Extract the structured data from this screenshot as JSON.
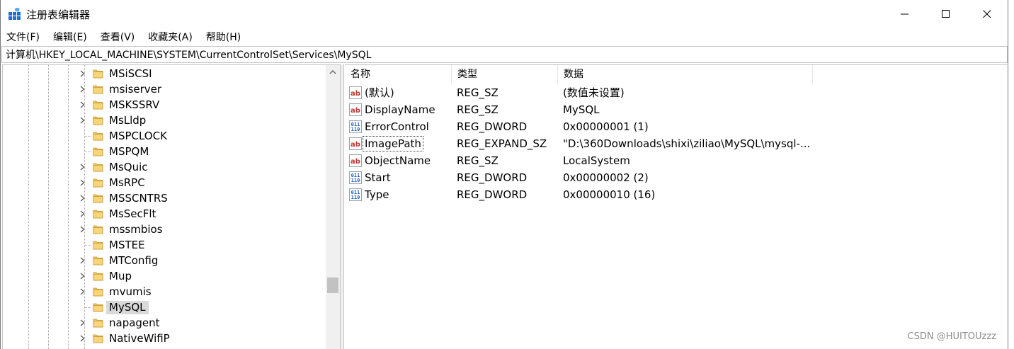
{
  "window": {
    "title": "注册表编辑器",
    "minimize_glyph": "minimize",
    "maximize_glyph": "maximize",
    "close_glyph": "close"
  },
  "menu": [
    {
      "label": "文件(F)"
    },
    {
      "label": "编辑(E)"
    },
    {
      "label": "查看(V)"
    },
    {
      "label": "收藏夹(A)"
    },
    {
      "label": "帮助(H)"
    }
  ],
  "address": {
    "path": "计算机\\HKEY_LOCAL_MACHINE\\SYSTEM\\CurrentControlSet\\Services\\MySQL"
  },
  "tree": {
    "items": [
      {
        "label": "MSiSCSI",
        "expandable": true,
        "selected": false
      },
      {
        "label": "msiserver",
        "expandable": true,
        "selected": false
      },
      {
        "label": "MSKSSRV",
        "expandable": true,
        "selected": false
      },
      {
        "label": "MsLldp",
        "expandable": true,
        "selected": false
      },
      {
        "label": "MSPCLOCK",
        "expandable": false,
        "selected": false
      },
      {
        "label": "MSPQM",
        "expandable": false,
        "selected": false
      },
      {
        "label": "MsQuic",
        "expandable": true,
        "selected": false
      },
      {
        "label": "MsRPC",
        "expandable": true,
        "selected": false
      },
      {
        "label": "MSSCNTRS",
        "expandable": true,
        "selected": false
      },
      {
        "label": "MsSecFlt",
        "expandable": true,
        "selected": false
      },
      {
        "label": "mssmbios",
        "expandable": true,
        "selected": false
      },
      {
        "label": "MSTEE",
        "expandable": false,
        "selected": false
      },
      {
        "label": "MTConfig",
        "expandable": true,
        "selected": false
      },
      {
        "label": "Mup",
        "expandable": true,
        "selected": false
      },
      {
        "label": "mvumis",
        "expandable": true,
        "selected": false
      },
      {
        "label": "MySQL",
        "expandable": false,
        "selected": true
      },
      {
        "label": "napagent",
        "expandable": true,
        "selected": false
      },
      {
        "label": "NativeWifiP",
        "expandable": true,
        "selected": false
      }
    ]
  },
  "list": {
    "columns": {
      "name": "名称",
      "type": "类型",
      "data": "数据"
    },
    "rows": [
      {
        "icon": "string-value-icon",
        "name": "(默认)",
        "type": "REG_SZ",
        "data": "(数值未设置)",
        "focused": false
      },
      {
        "icon": "string-value-icon",
        "name": "DisplayName",
        "type": "REG_SZ",
        "data": "MySQL",
        "focused": false
      },
      {
        "icon": "binary-value-icon",
        "name": "ErrorControl",
        "type": "REG_DWORD",
        "data": "0x00000001 (1)",
        "focused": false
      },
      {
        "icon": "string-value-icon",
        "name": "ImagePath",
        "type": "REG_EXPAND_SZ",
        "data": "\"D:\\360Downloads\\shixi\\ziliao\\MySQL\\mysql-...",
        "focused": true
      },
      {
        "icon": "string-value-icon",
        "name": "ObjectName",
        "type": "REG_SZ",
        "data": "LocalSystem",
        "focused": false
      },
      {
        "icon": "binary-value-icon",
        "name": "Start",
        "type": "REG_DWORD",
        "data": "0x00000002 (2)",
        "focused": false
      },
      {
        "icon": "binary-value-icon",
        "name": "Type",
        "type": "REG_DWORD",
        "data": "0x00000010 (16)",
        "focused": false
      }
    ]
  },
  "watermark": "CSDN @HUITOUzzz",
  "colors": {
    "folder": "#f2c55c",
    "selection": "#d9d9d9",
    "string_icon_red": "#c0392b",
    "binary_icon_blue": "#1f5fbf"
  }
}
